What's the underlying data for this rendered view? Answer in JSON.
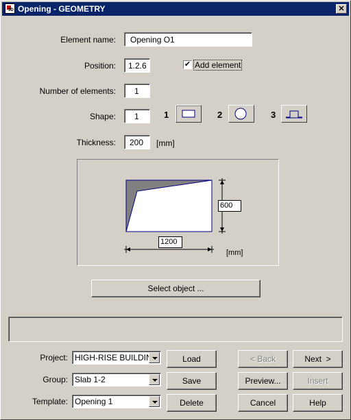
{
  "window": {
    "title": "Opening - GEOMETRY",
    "close_label": "✕"
  },
  "form": {
    "element_name_label": "Element name:",
    "element_name_value": "Opening O1",
    "position_label": "Position:",
    "position_value": "1.2.6",
    "add_element_label": "Add element",
    "add_element_checked": true,
    "number_label": "Number of elements:",
    "number_value": "1",
    "shape_label": "Shape:",
    "shape_value": "1",
    "shape_options": [
      "1",
      "2",
      "3"
    ],
    "thickness_label": "Thickness:",
    "thickness_value": "200",
    "thickness_unit": "[mm]"
  },
  "preview": {
    "width_value": "1200",
    "height_value": "600",
    "unit": "[mm]"
  },
  "select_object_label": "Select object ...",
  "bottom": {
    "project_label": "Project:",
    "project_value": "HIGH-RISE BUILDING",
    "group_label": "Group:",
    "group_value": "Slab 1-2",
    "template_label": "Template:",
    "template_value": "Opening 1",
    "load": "Load",
    "save": "Save",
    "delete": "Delete",
    "back": "< Back",
    "next": "Next  >",
    "preview": "Preview...",
    "insert": "Insert",
    "cancel": "Cancel",
    "help": "Help"
  },
  "colors": {
    "titlebar": "#0a246a",
    "shape_fill_dark": "#808080",
    "outline": "#000080"
  }
}
